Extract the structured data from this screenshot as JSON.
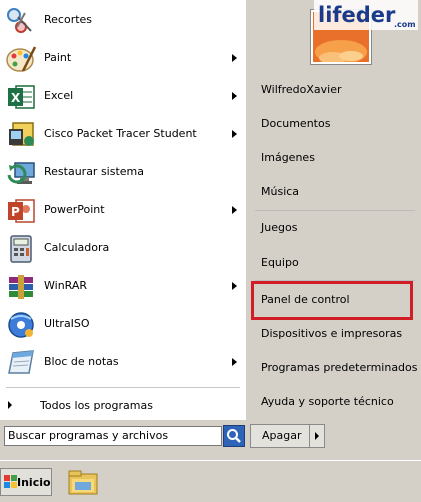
{
  "programs": [
    {
      "label": "Recortes",
      "icon": "scissors-icon",
      "submenu": false
    },
    {
      "label": "Paint",
      "icon": "paint-palette-icon",
      "submenu": true
    },
    {
      "label": "Excel",
      "icon": "excel-icon",
      "submenu": true
    },
    {
      "label": "Cisco Packet Tracer Student",
      "icon": "cisco-packet-tracer-icon",
      "submenu": true
    },
    {
      "label": "Restaurar sistema",
      "icon": "system-restore-icon",
      "submenu": false
    },
    {
      "label": "PowerPoint",
      "icon": "powerpoint-icon",
      "submenu": true
    },
    {
      "label": "Calculadora",
      "icon": "calculator-icon",
      "submenu": false
    },
    {
      "label": "WinRAR",
      "icon": "winrar-icon",
      "submenu": true
    },
    {
      "label": "UltraISO",
      "icon": "ultraiso-icon",
      "submenu": false
    },
    {
      "label": "Bloc de notas",
      "icon": "notepad-icon",
      "submenu": true
    }
  ],
  "all_programs_label": "Todos los programas",
  "search": {
    "placeholder": "Buscar programas y archivos"
  },
  "right_items": [
    {
      "label": "WilfredoXavier"
    },
    {
      "label": "Documentos"
    },
    {
      "label": "Imágenes"
    },
    {
      "label": "Música"
    },
    {
      "label": "Juegos"
    },
    {
      "label": "Equipo"
    },
    {
      "label": "Panel de control"
    },
    {
      "label": "Dispositivos e impresoras"
    },
    {
      "label": "Programas predeterminados"
    },
    {
      "label": "Ayuda y soporte técnico"
    }
  ],
  "highlighted_item": "Panel de control",
  "highlight_color": "#d11d25",
  "shutdown_label": "Apagar",
  "start_label": "Inicio",
  "watermark": "lifeder.com"
}
